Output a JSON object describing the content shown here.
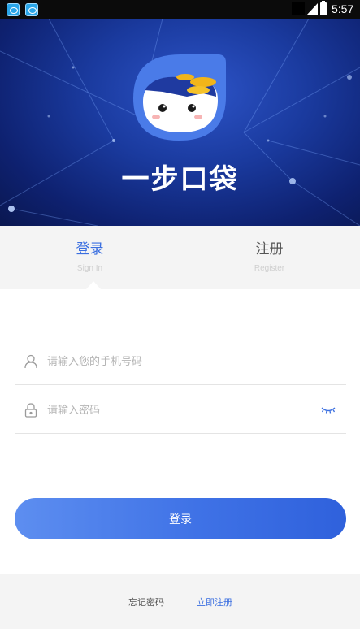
{
  "status_bar": {
    "time": "5:57"
  },
  "banner": {
    "app_name": "一步口袋"
  },
  "tabs": [
    {
      "label": "登录",
      "sublabel": "Sign In"
    },
    {
      "label": "注册",
      "sublabel": "Register"
    }
  ],
  "form": {
    "phone_placeholder": "请输入您的手机号码",
    "password_placeholder": "请输入密码",
    "login_button": "登录"
  },
  "footer": {
    "forgot_password": "忘记密码",
    "register_now": "立即注册"
  },
  "colors": {
    "accent": "#3b6fe0",
    "banner_bg": "#1a3a9e",
    "button_start": "#5d8ef0",
    "button_end": "#2f61dc"
  }
}
